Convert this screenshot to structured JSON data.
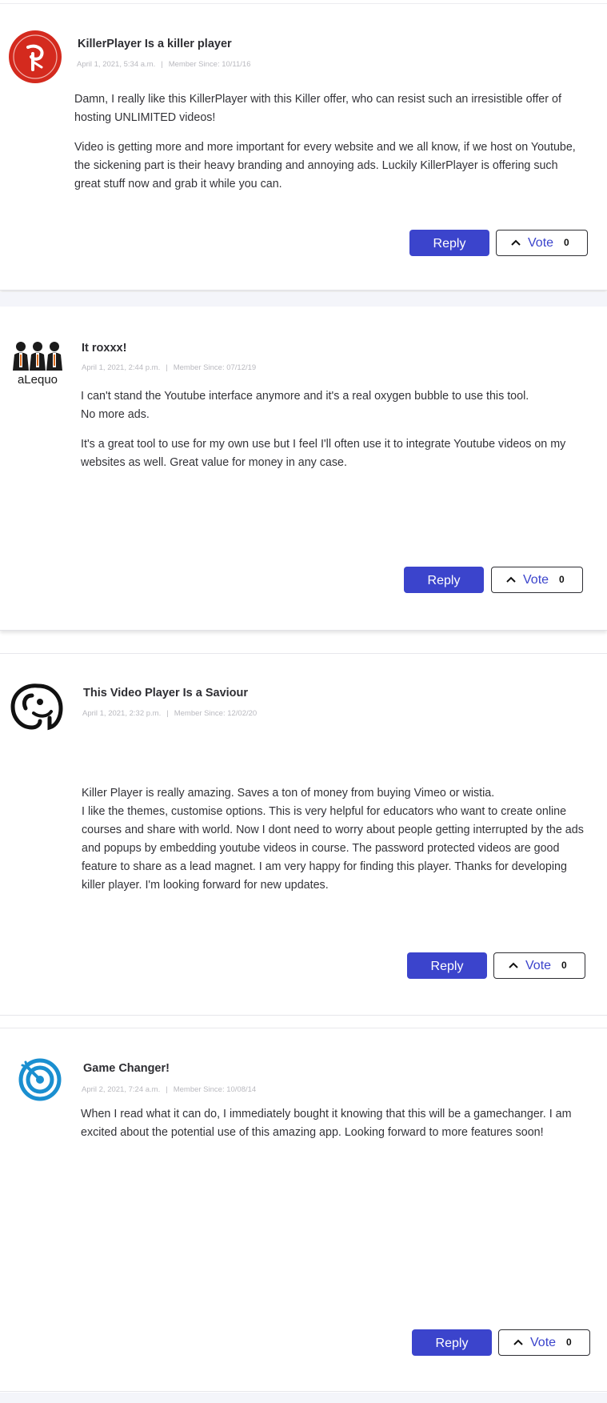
{
  "reviews": [
    {
      "title": "KillerPlayer Is a killer player",
      "date": "April 1, 2021, 5:34 a.m.",
      "separator": "|",
      "member_since": "Member Since: 10/11/16",
      "avatar_icon": "killerplayer-logo-icon",
      "paragraphs": [
        "Damn, I really like this KillerPlayer with this Killer offer, who can resist such an irresistible offer of hosting UNLIMITED videos!",
        "Video is getting more and more important for every website and we all know, if we host on Youtube, the sickening part is their heavy branding and annoying ads. Luckily KillerPlayer is offering such great stuff now and grab it while you can."
      ],
      "reply_label": "Reply",
      "vote_label": "Vote",
      "vote_count": "0"
    },
    {
      "title": "It roxxx!",
      "date": "April 1, 2021, 2:44 p.m.",
      "separator": "|",
      "member_since": "Member Since: 07/12/19",
      "avatar_icon": "alequo-team-logo-icon",
      "avatar_text": "aLequo",
      "paragraphs": [
        "I can't stand the Youtube interface anymore and it's a real oxygen bubble to use this tool.\nNo more ads.",
        "It's a great tool to use for my own use but I feel I'll often use it to integrate Youtube videos on my websites as well. Great value for money in any case."
      ],
      "reply_label": "Reply",
      "vote_label": "Vote",
      "vote_count": "0"
    },
    {
      "title": "This Video Player Is a Saviour",
      "date": "April 1, 2021, 2:32 p.m.",
      "separator": "|",
      "member_since": "Member Since: 12/02/20",
      "avatar_icon": "elephant-logo-icon",
      "paragraphs": [
        "Killer Player is really amazing. Saves a ton of money from buying Vimeo or wistia.\nI like the themes, customise options. This is very helpful for educators who want to create online courses and share with world. Now I dont need to worry about people getting interrupted by the ads and popups by embedding youtube videos in course. The password protected videos are good feature to share as a lead magnet. I am very happy for finding this player. Thanks for developing killer player. I'm looking forward for new updates."
      ],
      "reply_label": "Reply",
      "vote_label": "Vote",
      "vote_count": "0"
    },
    {
      "title": "Game Changer!",
      "date": "April 2, 2021, 7:24 a.m.",
      "separator": "|",
      "member_since": "Member Since: 10/08/14",
      "avatar_icon": "target-arrow-logo-icon",
      "paragraphs": [
        "When I read what it can do, I immediately bought it knowing that this will be a gamechanger. I am excited about the potential use of this amazing app. Looking forward to more features soon!"
      ],
      "reply_label": "Reply",
      "vote_label": "Vote",
      "vote_count": "0"
    }
  ],
  "colors": {
    "accent": "#3b44cc",
    "avatar_red": "#d42a1e",
    "avatar_blue": "#1a8fd0",
    "meta_gray": "#b9b9bf"
  }
}
